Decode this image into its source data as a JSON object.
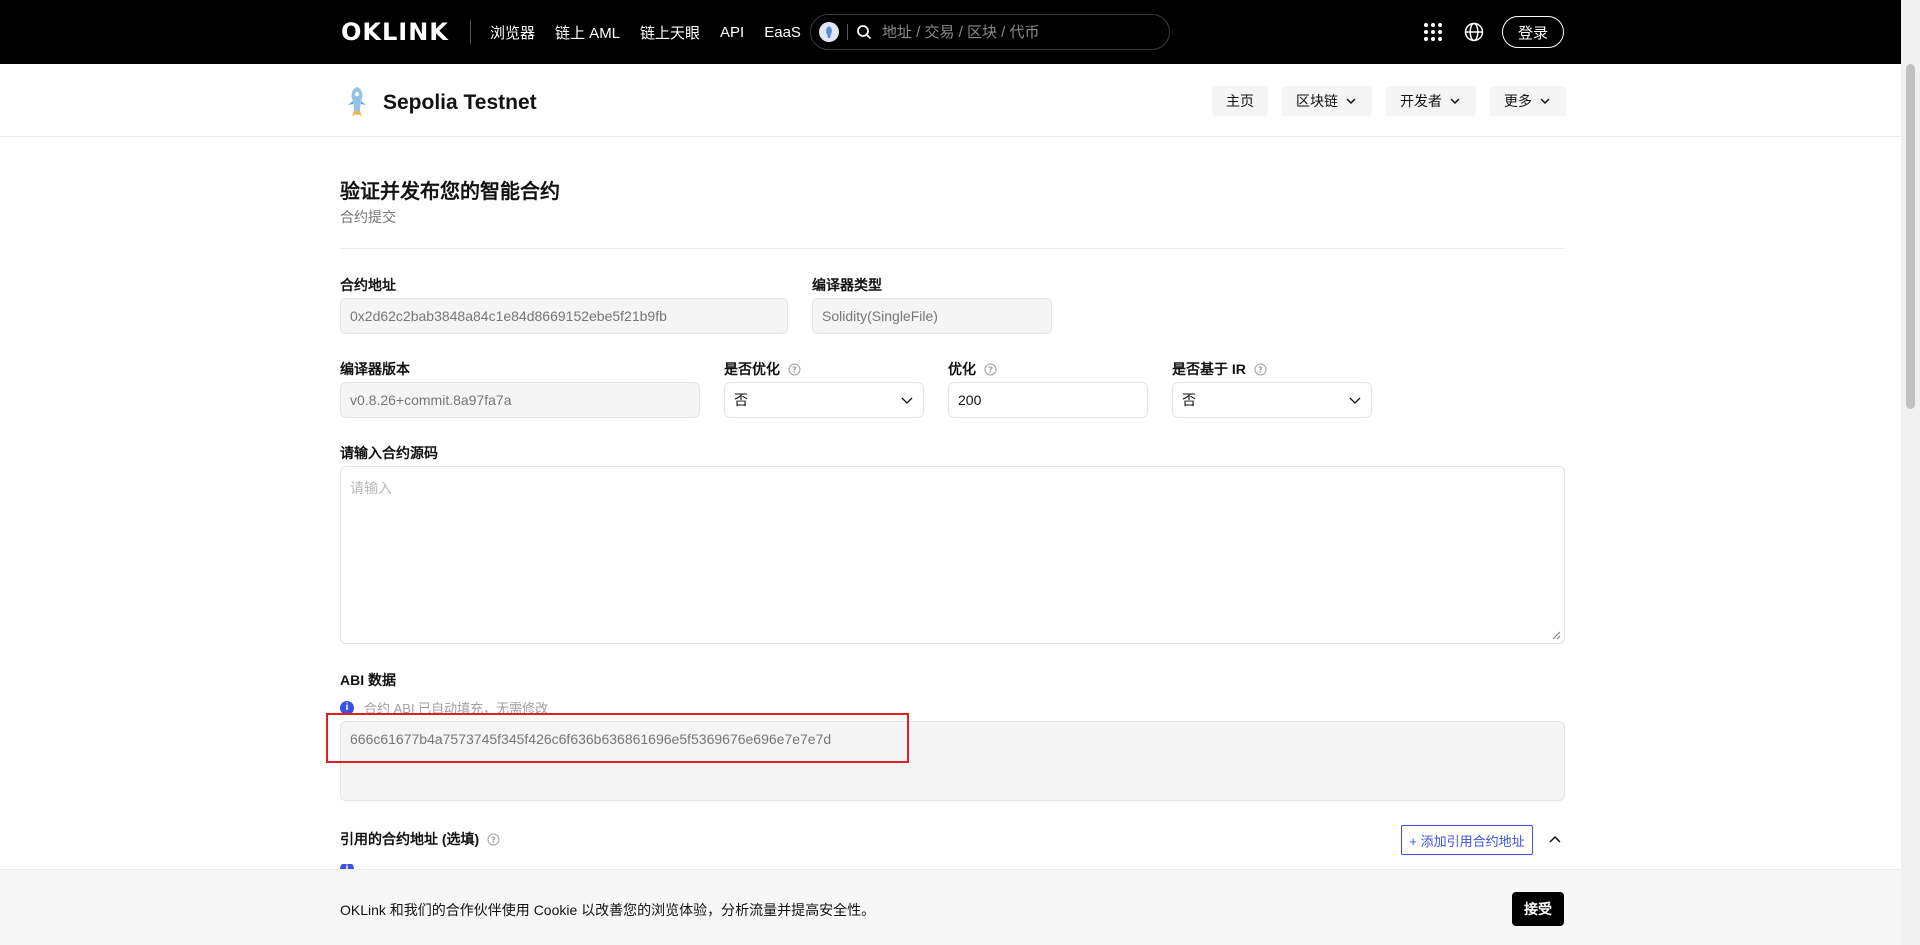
{
  "topnav": {
    "logo": "OKLINK",
    "links": [
      "浏览器",
      "链上 AML",
      "链上天眼",
      "API",
      "EaaS"
    ],
    "search_placeholder": "地址 / 交易 / 区块 / 代币",
    "login_label": "登录"
  },
  "subheader": {
    "chain_name": "Sepolia Testnet",
    "nav": [
      {
        "label": "主页",
        "chevron": false
      },
      {
        "label": "区块链",
        "chevron": true
      },
      {
        "label": "开发者",
        "chevron": true
      },
      {
        "label": "更多",
        "chevron": true
      }
    ]
  },
  "page": {
    "title": "验证并发布您的智能合约",
    "subtitle": "合约提交"
  },
  "form": {
    "contract_address_label": "合约地址",
    "contract_address_value": "0x2d62c2bab3848a84c1e84d8669152ebe5f21b9fb",
    "compiler_type_label": "编译器类型",
    "compiler_type_value": "Solidity(SingleFile)",
    "compiler_version_label": "编译器版本",
    "compiler_version_value": "v0.8.26+commit.8a97fa7a",
    "optimize_label": "是否优化",
    "optimize_value": "否",
    "runs_label": "优化",
    "runs_value": "200",
    "via_ir_label": "是否基于 IR",
    "via_ir_value": "否",
    "source_label": "请输入合约源码",
    "source_placeholder": "请输入",
    "abi_label": "ABI 数据",
    "abi_info": "合约 ABI 已自动填充，无需修改",
    "abi_value": "666c61677b4a7573745f345f426c6f636b636861696e5f5369676e696e7e7e7d",
    "refs_label": "引用的合约地址 (选填)",
    "add_ref_label": "+ 添加引用合约地址"
  },
  "cookie": {
    "text": "OKLink 和我们的合作伙伴使用 Cookie 以改善您的浏览体验，分析流量并提高安全性。",
    "accept_label": "接受"
  },
  "colors": {
    "accent": "#3b51e8",
    "highlight": "#e02020",
    "nav_bg": "#000000"
  }
}
